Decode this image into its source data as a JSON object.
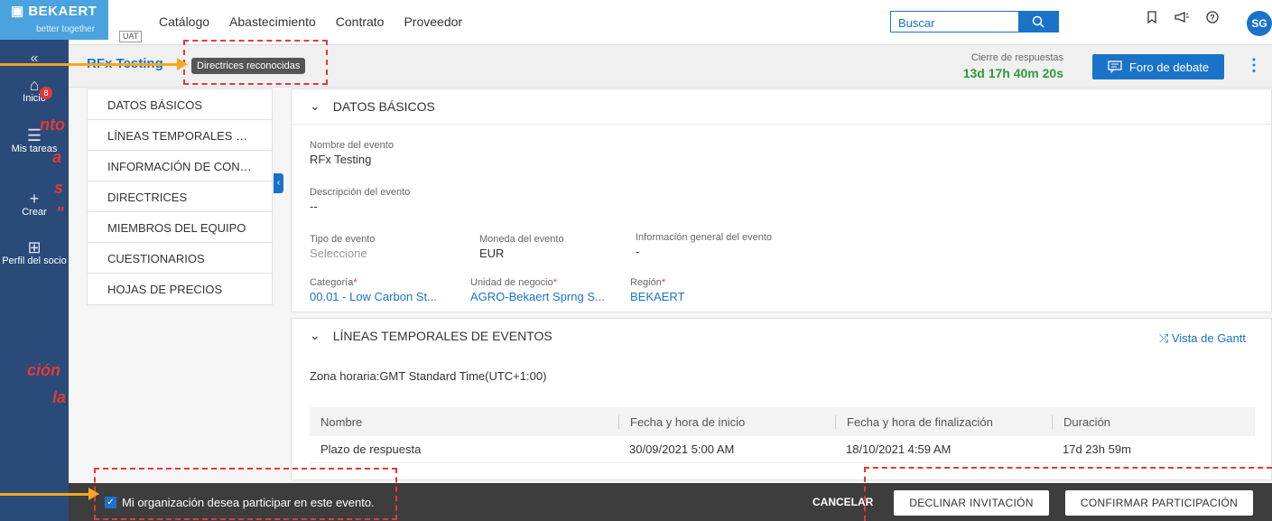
{
  "brand": {
    "name": "BEKAERT",
    "tagline": "better together",
    "env": "UAT"
  },
  "nav": [
    "Catálogo",
    "Abastecimiento",
    "Contrato",
    "Proveedor"
  ],
  "search": {
    "placeholder": "Buscar"
  },
  "user": {
    "initials": "SG"
  },
  "sidebar": {
    "items": [
      {
        "label": "Inicio",
        "icon": "home-icon"
      },
      {
        "label": "Mis tareas",
        "icon": "tasks-icon",
        "badge": "8"
      },
      {
        "label": "Crear",
        "icon": "plus-icon"
      },
      {
        "label": "Perfil del socio",
        "icon": "partner-profile-icon"
      }
    ]
  },
  "overlay_fragments": [
    "nto",
    "a",
    "s",
    "\"",
    "ción",
    "la"
  ],
  "header": {
    "title": "RFx Testing",
    "pill": "Directrices reconocidas",
    "closing_label": "Cierre de respuestas",
    "closing_value": "13d 17h 40m 20s",
    "forum_button": "Foro de debate"
  },
  "section_nav": [
    "DATOS BÁSICOS",
    "LÍNEAS TEMPORALES DE...",
    "INFORMACIÓN DE CONT...",
    "DIRECTRICES",
    "MIEMBROS DEL EQUIPO",
    "CUESTIONARIOS",
    "HOJAS DE PRECIOS"
  ],
  "basic": {
    "heading": "DATOS BÁSICOS",
    "event_name_label": "Nombre del evento",
    "event_name": "RFx Testing",
    "description_label": "Descripción del evento",
    "description": "--",
    "event_type_label": "Tipo de evento",
    "event_type": "Seleccione",
    "currency_label": "Moneda del evento",
    "currency": "EUR",
    "general_info_label": "Información general del evento",
    "general_info": "-",
    "category_label": "Categoría",
    "category": "00.01 - Low Carbon St...",
    "business_unit_label": "Unidad de negocio",
    "business_unit": "AGRO-Bekaert Sprng S...",
    "region_label": "Región",
    "region": "BEKAERT",
    "required_mark": "*"
  },
  "timelines": {
    "heading": "LÍNEAS TEMPORALES DE EVENTOS",
    "gantt_link": "Vista de Gantt",
    "timezone": "Zona horaria:GMT Standard Time(UTC+1:00)",
    "columns": [
      "Nombre",
      "Fecha y hora de inicio",
      "Fecha y hora de finalización",
      "Duración"
    ],
    "rows": [
      [
        "Plazo de respuesta",
        "30/09/2021 5:00 AM",
        "18/10/2021 4:59 AM",
        "17d 23h 59m"
      ]
    ]
  },
  "footer": {
    "participate_label": "Mi organización desea participar en este evento.",
    "participate_checked": true,
    "cancel": "CANCELAR",
    "decline": "DECLINAR INVITACIÓN",
    "confirm": "CONFIRMAR PARTICIPACIÓN"
  },
  "colors": {
    "accent": "#1a73c8",
    "sidebar": "#2a4a7a",
    "annotation_red": "#e53935",
    "annotation_arrow": "#f5a623",
    "countdown": "#2e9b3a"
  }
}
